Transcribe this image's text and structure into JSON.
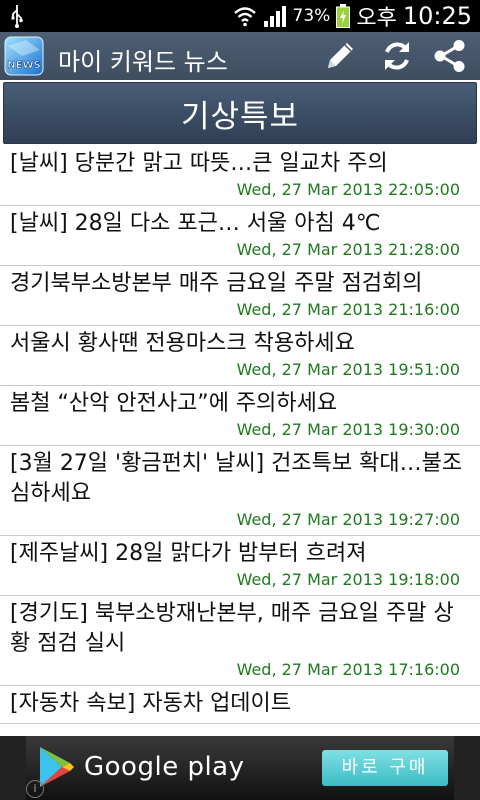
{
  "status_bar": {
    "battery_percent": "73%",
    "ampm": "오후",
    "time": "10:25"
  },
  "action_bar": {
    "app_icon_text": "NEWS",
    "title": "마이 키워드 뉴스"
  },
  "section": {
    "title": "기상특보"
  },
  "news": [
    {
      "title": "[날씨] 당분간 맑고 따뜻…큰 일교차 주의",
      "date": "Wed, 27 Mar 2013 22:05:00"
    },
    {
      "title": "[날씨] 28일 다소 포근… 서울 아침 4℃",
      "date": "Wed, 27 Mar 2013 21:28:00"
    },
    {
      "title": "경기북부소방본부 매주 금요일 주말 점검회의",
      "date": "Wed, 27 Mar 2013 21:16:00"
    },
    {
      "title": "서울시 황사땐 전용마스크 착용하세요",
      "date": "Wed, 27 Mar 2013 19:51:00"
    },
    {
      "title": "봄철 “산악 안전사고”에 주의하세요",
      "date": "Wed, 27 Mar 2013 19:30:00"
    },
    {
      "title": "[3월 27일 '황금펀치' 날씨] 건조특보 확대…불조심하세요",
      "date": "Wed, 27 Mar 2013 19:27:00"
    },
    {
      "title": "[제주날씨] 28일 맑다가 밤부터 흐려져",
      "date": "Wed, 27 Mar 2013 19:18:00"
    },
    {
      "title": "[경기도] 북부소방재난본부, 매주 금요일 주말 상황 점검 실시",
      "date": "Wed, 27 Mar 2013 17:16:00"
    },
    {
      "title": "[자동차 속보] 자동차 업데이트",
      "date": ""
    }
  ],
  "ad": {
    "brand": "Google play",
    "button": "바로 구매",
    "info": "i"
  },
  "colors": {
    "action_bar": "#46566a",
    "date_text": "#1f7a1f",
    "ad_button": "#4cc6cd"
  }
}
